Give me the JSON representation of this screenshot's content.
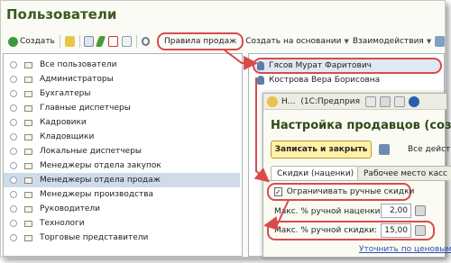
{
  "window": {
    "title": "Пользователи"
  },
  "toolbar": {
    "create_label": "Создать",
    "rights_button": "Правила продаж",
    "create_based_on": "Создать на основании",
    "interactions": "Взаимодействия"
  },
  "groups": [
    "Все пользователи",
    "Администраторы",
    "Бухгалтеры",
    "Главные диспетчеры",
    "Кадровики",
    "Кладовщики",
    "Локальные диспетчеры",
    "Менеджеры отдела закупок",
    "Менеджеры отдела продаж",
    "Менеджеры производства",
    "Руководители",
    "Технологи",
    "Торговые представители"
  ],
  "selected_group_index": 8,
  "users": [
    {
      "name": "Гясов Мурат Фаритович",
      "selected": true
    },
    {
      "name": "Кострова Вера Борисовна",
      "selected": false
    }
  ],
  "modal": {
    "window_title_short": "Н...",
    "window_title": "(1С:Предприя",
    "heading": "Настройка продавцов (созд",
    "save_close_button": "Записать и закрыть",
    "all_actions": "Все действ",
    "tabs": [
      "Скидки (наценки)",
      "Рабочее место касс"
    ],
    "checkbox_label": "Ограничивать ручные скидки",
    "checkbox_checked": true,
    "max_markup_label": "Макс. % ручной наценки:",
    "max_markup_value": "2,00",
    "max_discount_label": "Макс. % ручной скидки:",
    "max_discount_value": "15,00",
    "footer_link": "Уточнить по ценовым гр"
  },
  "colors": {
    "title": "#3c5a1e",
    "highlight": "#d94b4b",
    "selection": "#cfdbe9",
    "primary_button": "#fff1a8"
  }
}
